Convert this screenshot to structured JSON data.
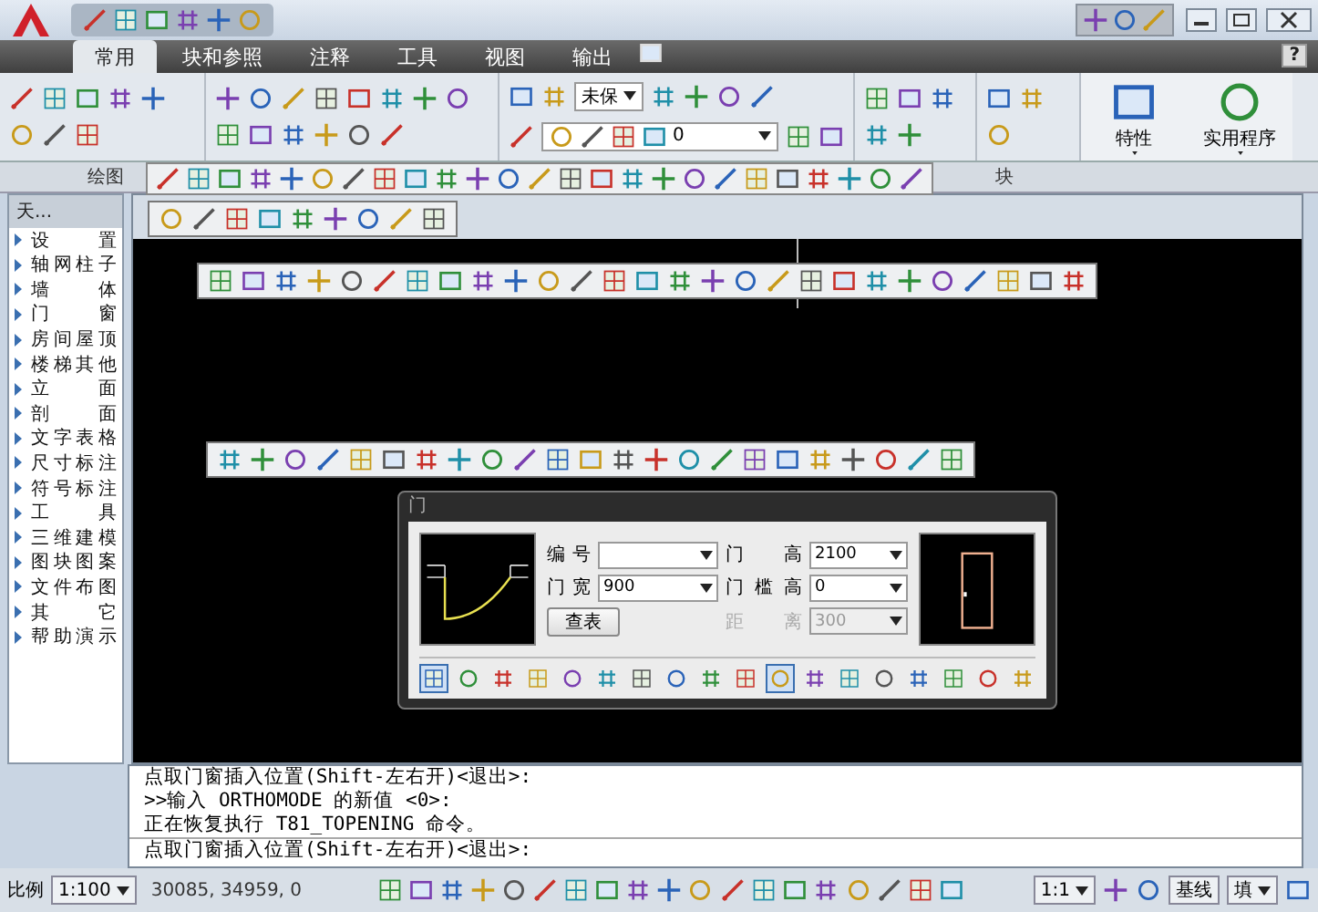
{
  "ribbon": {
    "tabs": [
      {
        "label": "常用",
        "selected": true
      },
      {
        "label": "块和参照",
        "selected": false
      },
      {
        "label": "注释",
        "selected": false
      },
      {
        "label": "工具",
        "selected": false
      },
      {
        "label": "视图",
        "selected": false
      },
      {
        "label": "输出",
        "selected": false
      }
    ],
    "help": "?",
    "layer_state": "未保",
    "layer_name": "0",
    "large_buttons": [
      {
        "label": "特性"
      },
      {
        "label": "实用程序"
      }
    ],
    "panel_titles": [
      "绘图",
      "块"
    ]
  },
  "sidebar": {
    "title": "天...",
    "items": [
      {
        "label": "设 置"
      },
      {
        "label": "轴网柱子"
      },
      {
        "label": "墙 体"
      },
      {
        "label": "门 窗"
      },
      {
        "label": "房间屋顶"
      },
      {
        "label": "楼梯其他"
      },
      {
        "label": "立 面"
      },
      {
        "label": "剖 面"
      },
      {
        "label": "文字表格"
      },
      {
        "label": "尺寸标注"
      },
      {
        "label": "符号标注"
      },
      {
        "label": "工 具"
      },
      {
        "label": "三维建模"
      },
      {
        "label": "图块图案"
      },
      {
        "label": "文件布图"
      },
      {
        "label": "其 它"
      },
      {
        "label": "帮助演示"
      }
    ]
  },
  "dialog": {
    "title": "门",
    "fields": [
      {
        "label": "编号",
        "disabled": false
      },
      {
        "label": "门 高",
        "value": "2100",
        "disabled": false
      },
      {
        "label": "门宽",
        "value": "900",
        "disabled": false
      },
      {
        "label": "门槛高",
        "value": "0",
        "disabled": false
      },
      {
        "label": "距 离",
        "value": "300",
        "disabled": true
      }
    ],
    "button": "查表",
    "mode_buttons": [
      {
        "selected": true
      },
      {
        "selected": false
      },
      {
        "selected": false
      },
      {
        "selected": false
      },
      {
        "selected": false
      },
      {
        "selected": false
      },
      {
        "selected": false
      },
      {
        "selected": false
      },
      {
        "selected": false
      },
      {
        "selected": false
      },
      {
        "selected": true
      },
      {
        "selected": false
      },
      {
        "selected": false
      },
      {
        "selected": false
      },
      {
        "selected": false
      },
      {
        "selected": false
      },
      {
        "selected": false
      },
      {
        "selected": false
      }
    ]
  },
  "command_line": {
    "history": [
      "点取门窗插入位置(Shift-左右开)<退出>:",
      ">>输入 ORTHOMODE 的新值 <0>:",
      "正在恢复执行 T81_TOPENING 命令。"
    ],
    "prompt": "点取门窗插入位置(Shift-左右开)<退出>:"
  },
  "status_bar": {
    "scale_label": "比例",
    "scale": "1:100",
    "coordinates": "30085, 34959, 0",
    "annotation_scale": "1:1",
    "baseline": "基线",
    "fill": "填"
  }
}
